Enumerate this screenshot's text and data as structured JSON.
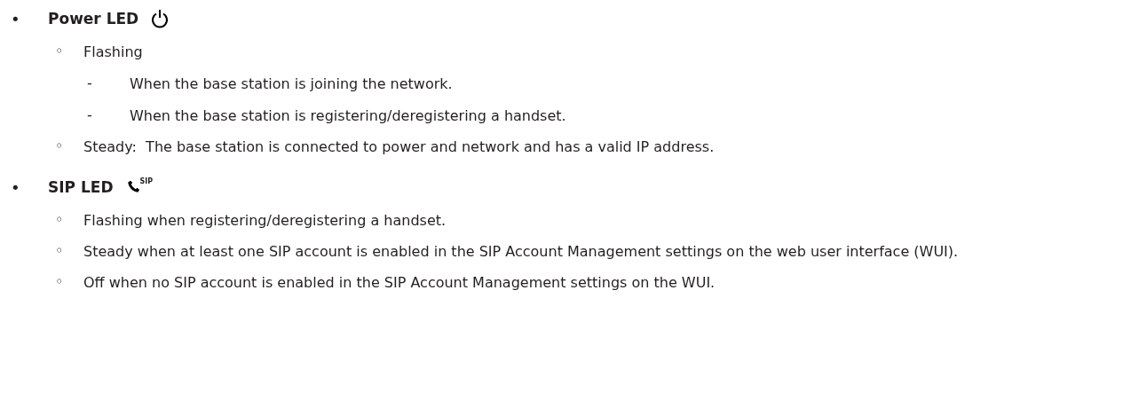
{
  "sections": [
    {
      "bullet": "•",
      "title": "Power LED",
      "icon": {
        "kind": "power"
      },
      "items": [
        {
          "bullet": "◦",
          "text": "Flashing",
          "children": [
            {
              "bullet": "-",
              "text": "When the base station is joining the network."
            },
            {
              "bullet": "-",
              "text": "When the base station is registering/deregistering a handset."
            }
          ]
        },
        {
          "bullet": "◦",
          "text": "Steady:  The base station is connected to power and network and has a valid IP address."
        }
      ]
    },
    {
      "bullet": "•",
      "title": "SIP LED",
      "icon": {
        "kind": "phone",
        "label": "SIP"
      },
      "items": [
        {
          "bullet": "◦",
          "text": "Flashing when registering/deregistering a handset."
        },
        {
          "bullet": "◦",
          "text": "Steady when at least one SIP account is enabled in the SIP Account Management settings on the web user interface (WUI)."
        },
        {
          "bullet": "◦",
          "text": "Off when no SIP account is enabled in the SIP Account Management settings on the WUI."
        }
      ]
    }
  ]
}
